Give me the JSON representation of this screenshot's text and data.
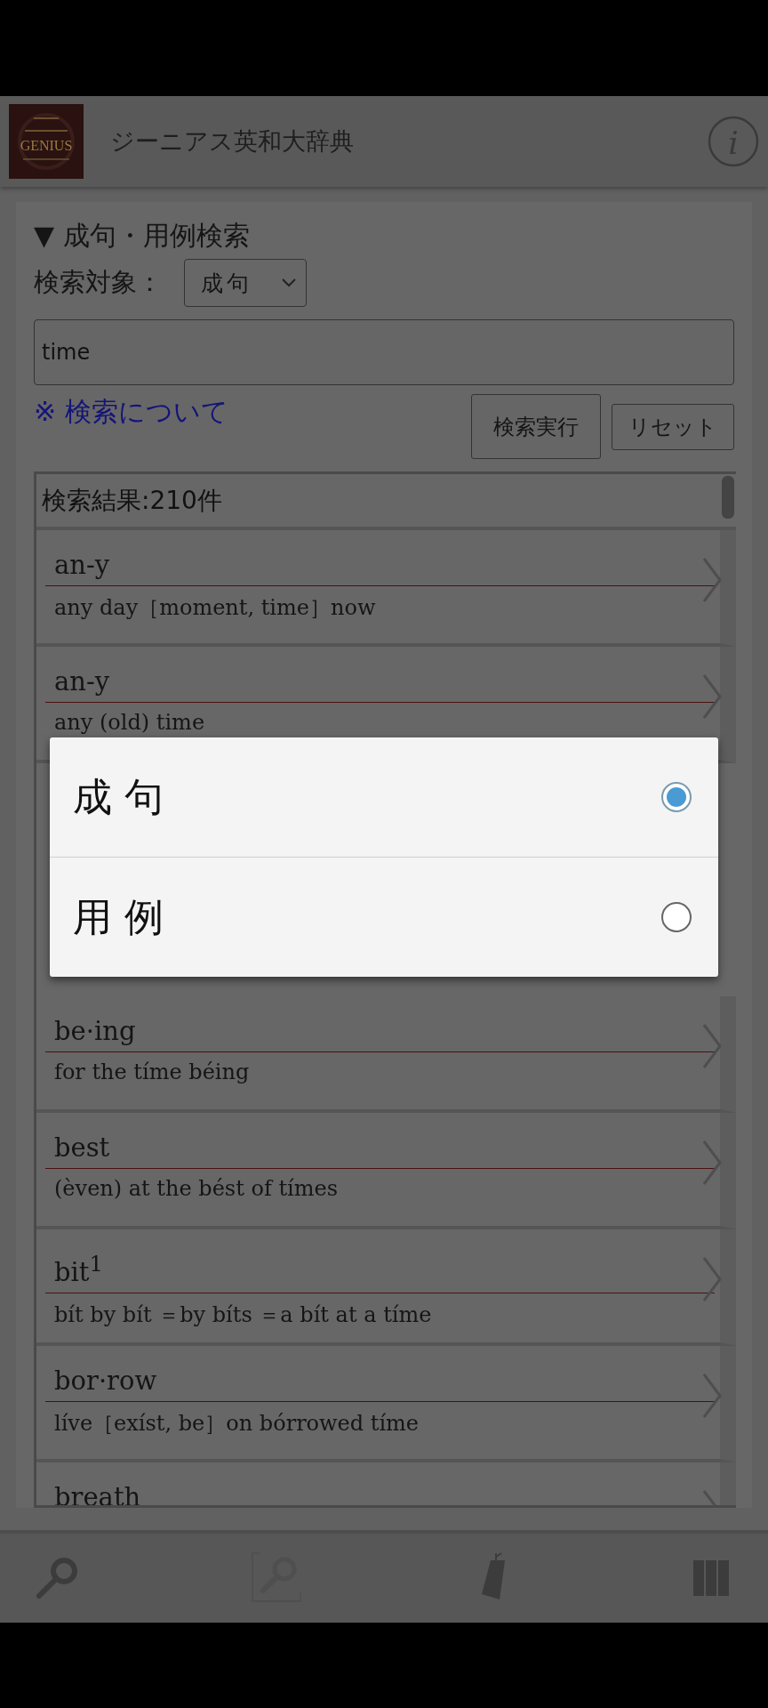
{
  "header": {
    "logo_text": "GENIUS",
    "title": "ジーニアス英和大辞典",
    "info_label": "i"
  },
  "search_panel": {
    "heading": "▼ 成句・用例検索",
    "target_label": "検索対象：",
    "target_value": "成句",
    "query": "time",
    "help_link": "※ 検索について",
    "buttons": [
      {
        "label": "検索実行",
        "kind": "primary"
      },
      {
        "label": "リセット",
        "kind": "secondary"
      }
    ]
  },
  "results": {
    "count_label": "検索結果:210件",
    "rows": [
      {
        "headword": "an-y",
        "phrase": "any day［moment, time］now"
      },
      {
        "headword": "an-y",
        "phrase": "any (old) time"
      },
      {
        "kind": "hidden"
      },
      {
        "kind": "hidden"
      },
      {
        "headword": "be·ing",
        "phrase": "for the tíme béing"
      },
      {
        "headword": "best",
        "phrase": "(èven) at the bést of tímes"
      },
      {
        "headword": "bit$^{1}$",
        "phrase": "bít by bít ＝by bíts ＝a bít at a tíme"
      },
      {
        "headword": "bor·row",
        "phrase": "líve［exíst, be］on bórrowed tíme"
      },
      {
        "headword": "breath",
        "kind": "cut"
      }
    ]
  },
  "dialog": {
    "options": [
      {
        "label": "成 句",
        "selected": true
      },
      {
        "label": "用 例",
        "selected": false
      }
    ]
  },
  "bottom_nav": [
    {
      "kind": "search",
      "disabled": false
    },
    {
      "kind": "search-frame",
      "disabled": true
    },
    {
      "kind": "tag",
      "disabled": false
    },
    {
      "kind": "columns",
      "disabled": false
    }
  ]
}
